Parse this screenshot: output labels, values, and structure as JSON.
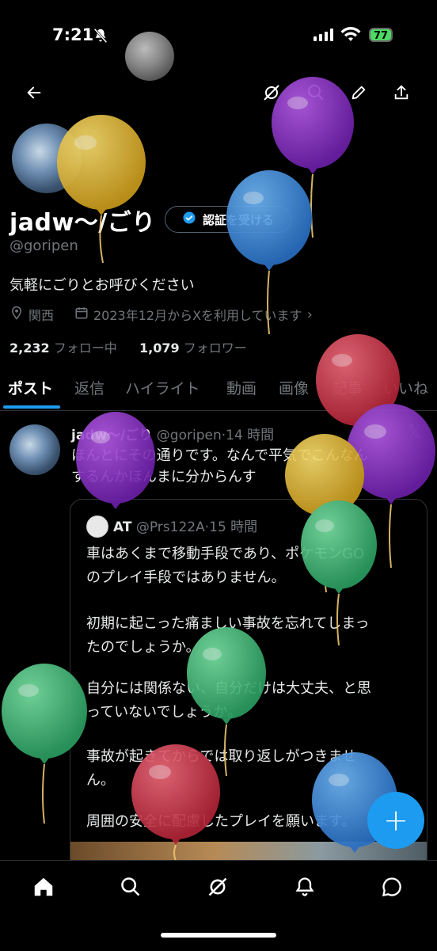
{
  "status_bar": {
    "time": "7:21",
    "battery": "77"
  },
  "profile": {
    "name": "jadw～/ごり",
    "verify_button": "認証を受ける",
    "handle": "@goripen",
    "bio": "気軽にごりとお呼びください",
    "location": "関西",
    "joined": "2023年12月からXを利用しています",
    "following_count": "2,232",
    "following_label": "フォロー中",
    "followers_count": "1,079",
    "followers_label": "フォロワー"
  },
  "tabs": [
    "ポスト",
    "返信",
    "ハイライト",
    "動画",
    "画像",
    "記事",
    "いいね"
  ],
  "post": {
    "author": "jadw～/ごり",
    "handle": "@goripen",
    "time": "14 時間",
    "text_lines": [
      "ほんとにその通りです。なんで平気でこんなん",
      "するんかほんまに分からんす"
    ]
  },
  "quote": {
    "author": "AT",
    "handle": "@Prs122A",
    "time": "15 時間",
    "lines": [
      "車はあくまで移動手段であり、ポケモンGO",
      "のプレイ手段ではありません。",
      "",
      "初期に起こった痛ましい事故を忘れてしまっ",
      "たのでしょうか。",
      "",
      "自分には関係ない、自分だけは大丈夫、と思",
      "っていないでしょうか。",
      "",
      "事故が起きてからでは取り返しがつきませ",
      "ん。",
      "",
      "周囲の安全に配慮したプレイを願います。"
    ]
  },
  "fab_label": "+",
  "colors": {
    "accent": "#1d9bf0",
    "background": "#000000",
    "muted": "#71767b"
  },
  "icons": [
    "back-arrow-icon",
    "grok-icon",
    "search-icon",
    "edit-icon",
    "share-icon",
    "home-icon",
    "bell-icon",
    "envelope-icon",
    "x-logo-icon",
    "location-icon",
    "calendar-icon",
    "verified-icon"
  ]
}
